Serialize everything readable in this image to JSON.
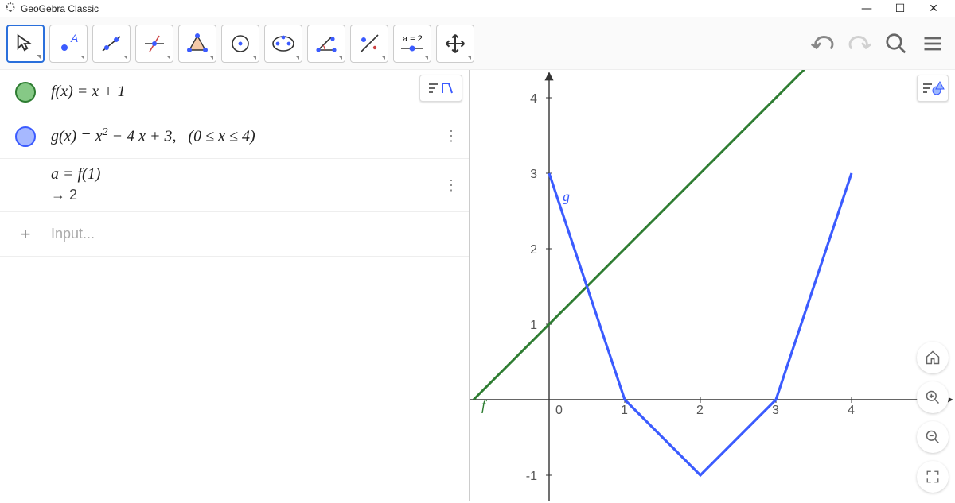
{
  "app": {
    "title": "GeoGebra Classic"
  },
  "window_controls": {
    "minimize": "—",
    "maximize": "☐",
    "close": "✕"
  },
  "toolbar_right": {
    "undo": "undo",
    "redo": "redo",
    "search": "search",
    "menu": "menu"
  },
  "algebra": {
    "rows": [
      {
        "color": "#4a9d4a",
        "expr": "f(x)  =  x + 1",
        "menu": "sort"
      },
      {
        "color": "#5b7fff",
        "expr_html": "g(x)  =  x<sup>2</sup> − 4 x + 3,&nbsp;&nbsp;&nbsp;(0 ≤ x ≤ 4)",
        "menu": "more"
      },
      {
        "color": "",
        "expr": "a  =  f(1)",
        "result": "→  2",
        "menu": "more"
      }
    ],
    "input_placeholder": "Input..."
  },
  "graphics": {
    "labels": {
      "f": "f",
      "g": "g"
    },
    "ticks_x": [
      "0",
      "1",
      "2",
      "3",
      "4"
    ],
    "ticks_y": [
      "-1",
      "1",
      "2",
      "3",
      "4"
    ]
  },
  "chart_data": {
    "type": "line",
    "xlim": [
      -1,
      4.5
    ],
    "ylim": [
      -1.5,
      4.5
    ],
    "series": [
      {
        "name": "f",
        "color": "#2e7d32",
        "expr": "x + 1",
        "x": [
          -1,
          0,
          1,
          2,
          3,
          4
        ],
        "y": [
          0,
          1,
          2,
          3,
          4,
          5
        ]
      },
      {
        "name": "g",
        "color": "#3b5bff",
        "expr": "x^2 - 4x + 3",
        "domain": [
          0,
          4
        ],
        "x": [
          0,
          0.5,
          1,
          1.5,
          2,
          2.5,
          3,
          3.5,
          4
        ],
        "y": [
          3,
          1.25,
          0,
          -0.75,
          -1,
          -0.75,
          0,
          1.25,
          3
        ]
      }
    ]
  },
  "corner_buttons": {
    "home": "⌂",
    "zoom_in": "+",
    "zoom_out": "−",
    "fullscreen": "⛶"
  }
}
